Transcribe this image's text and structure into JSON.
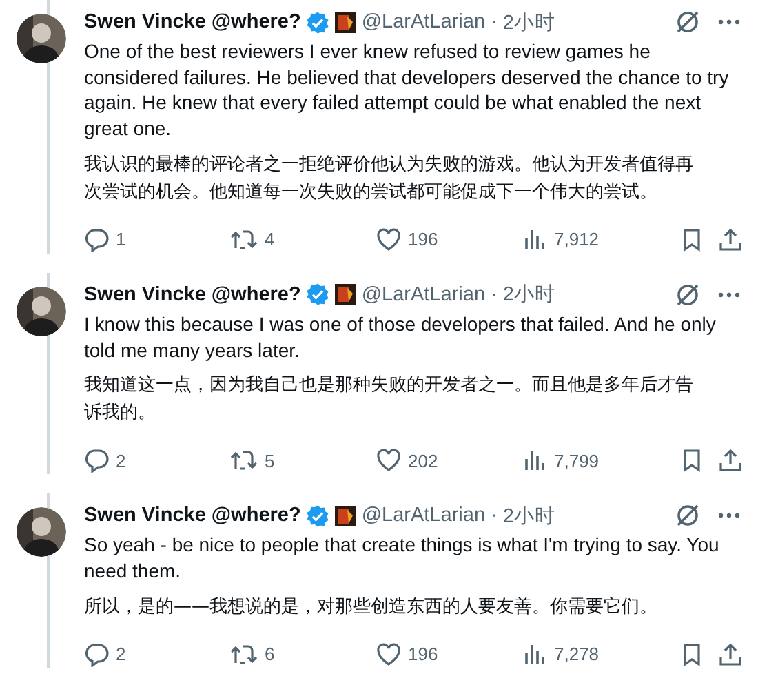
{
  "tweets": [
    {
      "name": "Swen Vincke @where?",
      "handle": "@LarAtLarian",
      "separator": "·",
      "time": "2小时",
      "text_en": "One of the best reviewers I ever knew refused to review games he considered failures. He believed that developers deserved the chance to try again. He knew that every failed attempt could be what enabled the next great one.",
      "text_zh": "我认识的最棒的评论者之一拒绝评价他认为失败的游戏。他认为开发者值得再次尝试的机会。他知道每一次失败的尝试都可能促成下一个伟大的尝试。",
      "replies": "1",
      "reposts": "4",
      "likes": "196",
      "views": "7,912"
    },
    {
      "name": "Swen Vincke @where?",
      "handle": "@LarAtLarian",
      "separator": "·",
      "time": "2小时",
      "text_en": "I know this because I was one of those developers that failed. And he only told me many years later.",
      "text_zh": "我知道这一点，因为我自己也是那种失败的开发者之一。而且他是多年后才告诉我的。",
      "replies": "2",
      "reposts": "5",
      "likes": "202",
      "views": "7,799"
    },
    {
      "name": "Swen Vincke @where?",
      "handle": "@LarAtLarian",
      "separator": "·",
      "time": "2小时",
      "text_en": "So yeah - be nice to people that create things is what I'm trying to say. You need them.",
      "text_zh": "所以，是的——我想说的是，对那些创造东西的人要友善。你需要它们。",
      "replies": "2",
      "reposts": "6",
      "likes": "196",
      "views": "7,278"
    }
  ]
}
